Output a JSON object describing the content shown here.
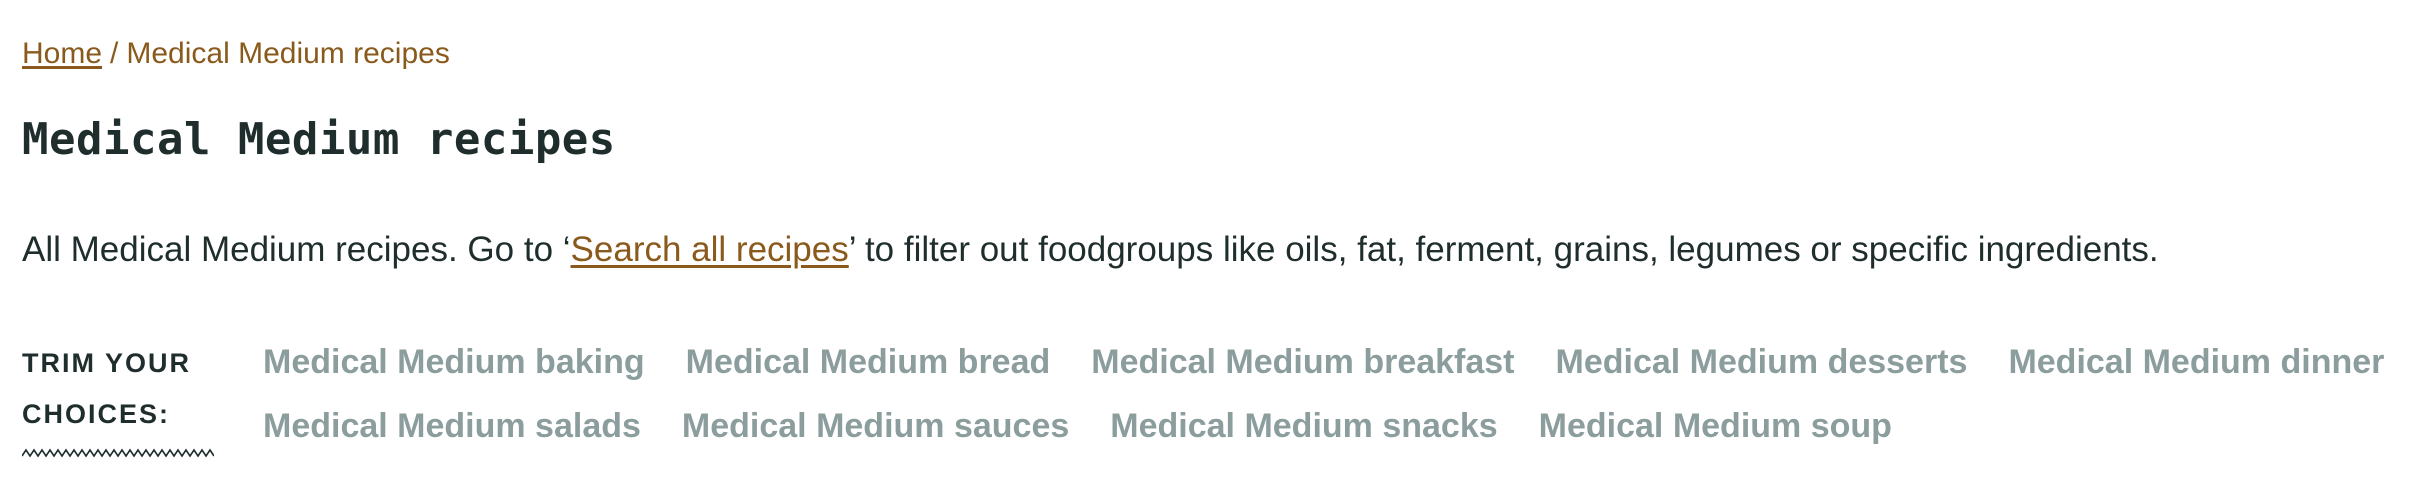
{
  "breadcrumb": {
    "home_label": "Home",
    "separator": "/",
    "current_label": "Medical Medium recipes"
  },
  "page": {
    "title": "Medical Medium recipes",
    "intro_before": "All Medical Medium recipes. Go to ‘",
    "intro_link": "Search all recipes",
    "intro_after": "’ to filter out foodgroups like oils, fat, ferment, grains, legumes or specific ingredients."
  },
  "trim": {
    "label_line1": "TRIM YOUR",
    "label_line2": "CHOICES:",
    "row1": [
      "Medical Medium baking",
      "Medical Medium bread",
      "Medical Medium breakfast",
      "Medical Medium desserts",
      "Medical Medium dinner"
    ],
    "row2": [
      "Medical Medium salads",
      "Medical Medium sauces",
      "Medical Medium snacks",
      "Medical Medium soup"
    ]
  },
  "colors": {
    "link_brown": "#8a5a1c",
    "text_dark": "#1f2d2d",
    "choice_gray": "#8c9d9d",
    "background": "#ffffff"
  }
}
